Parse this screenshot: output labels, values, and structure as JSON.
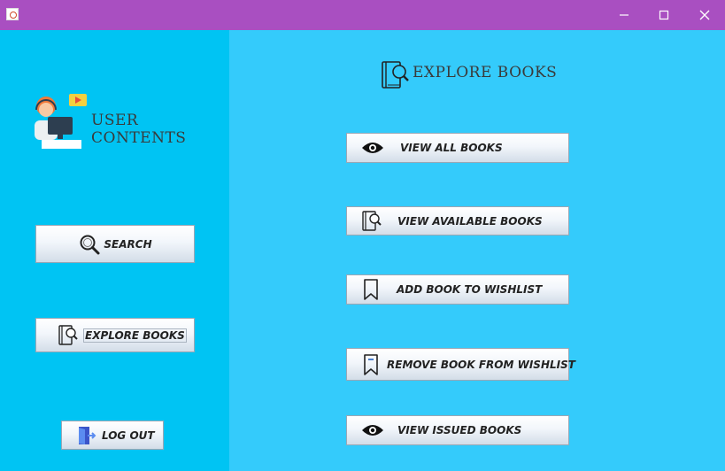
{
  "window": {
    "minimize_icon": "minimize-icon",
    "maximize_icon": "maximize-icon",
    "close_icon": "close-icon"
  },
  "left_panel": {
    "heading": "USER CONTENTS",
    "buttons": {
      "search": "SEARCH",
      "explore": "EXPLORE BOOKS",
      "logout": "LOG OUT"
    }
  },
  "right_panel": {
    "heading": "EXPLORE BOOKS",
    "buttons": {
      "view_all": "VIEW ALL BOOKS",
      "view_available": "VIEW AVAILABLE BOOKS",
      "add_wishlist": "ADD BOOK TO WISHLIST",
      "remove_wishlist": "REMOVE BOOK FROM WISHLIST",
      "view_issued": "VIEW ISSUED BOOKS"
    }
  },
  "colors": {
    "titlebar": "#a94fc1",
    "left_panel": "#00c4f3",
    "right_panel": "#34cbfb"
  }
}
